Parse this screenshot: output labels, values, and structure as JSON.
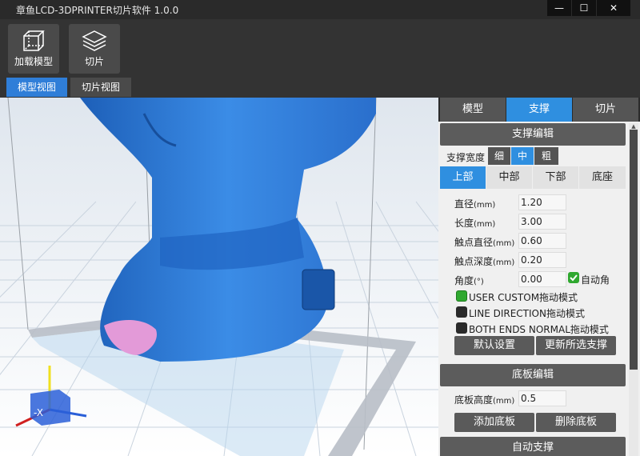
{
  "window": {
    "title": "章鱼LCD-3DPRINTER切片软件 1.0.0",
    "minimize": "—",
    "maximize": "☐",
    "close": "✕"
  },
  "toolbar": {
    "load_model": "加载模型",
    "slice": "切片"
  },
  "view_tabs": [
    "模型视图",
    "切片视图"
  ],
  "panel": {
    "tabs": [
      "模型",
      "支撑",
      "切片"
    ],
    "active_tab": "支撑",
    "support_edit": {
      "heading": "支撑编辑",
      "width_label": "支撑宽度",
      "width_options": [
        "细",
        "中",
        "粗"
      ],
      "width_selected": "中",
      "position_tabs": [
        "上部",
        "中部",
        "下部",
        "底座"
      ],
      "active_position": "上部",
      "fields": [
        {
          "label": "直径",
          "unit": "(mm)",
          "value": "1.20"
        },
        {
          "label": "长度",
          "unit": "(mm)",
          "value": "3.00"
        },
        {
          "label": "触点直径",
          "unit": "(mm)",
          "value": "0.60"
        },
        {
          "label": "触点深度",
          "unit": "(mm)",
          "value": "0.20"
        },
        {
          "label": "角度",
          "unit": "(°)",
          "value": "0.00"
        }
      ],
      "auto_angle": "自动角",
      "modes": [
        {
          "label": "USER CUSTOM拖动模式",
          "color": "#2fa82f"
        },
        {
          "label": "LINE DIRECTION拖动模式",
          "color": "#2a2a2a"
        },
        {
          "label": "BOTH ENDS NORMAL拖动模式",
          "color": "#2a2a2a"
        }
      ],
      "default_button": "默认设置",
      "update_button": "更新所选支撑"
    },
    "base_edit": {
      "heading": "底板编辑",
      "height_label": "底板高度",
      "height_unit": "(mm)",
      "height_value": "0.5",
      "add_button": "添加底板",
      "delete_button": "删除底板"
    },
    "auto_support": {
      "heading": "自动支撑"
    }
  },
  "colors": {
    "accent": "#2f8fe0",
    "model": "#2e7fd6",
    "support_overlay": "#e39ad8"
  }
}
